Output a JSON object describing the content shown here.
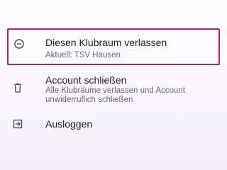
{
  "menu": {
    "leave": {
      "icon": "minus-circle-icon",
      "title": "Diesen Klubraum verlassen",
      "subtitle": "Aktuell: TSV Hausen"
    },
    "delete_account": {
      "icon": "trash-icon",
      "title": "Account schließen",
      "subtitle_line1": "Alle Klubräume verlassen und Account",
      "subtitle_line2": "unwiderruflich schließen"
    },
    "logout": {
      "icon": "logout-icon",
      "title": "Ausloggen"
    }
  },
  "colors": {
    "highlight_border": "#b0246a",
    "title_text": "#1d1b20",
    "subtitle_text": "#6b6870",
    "icon": "#4a4650"
  }
}
